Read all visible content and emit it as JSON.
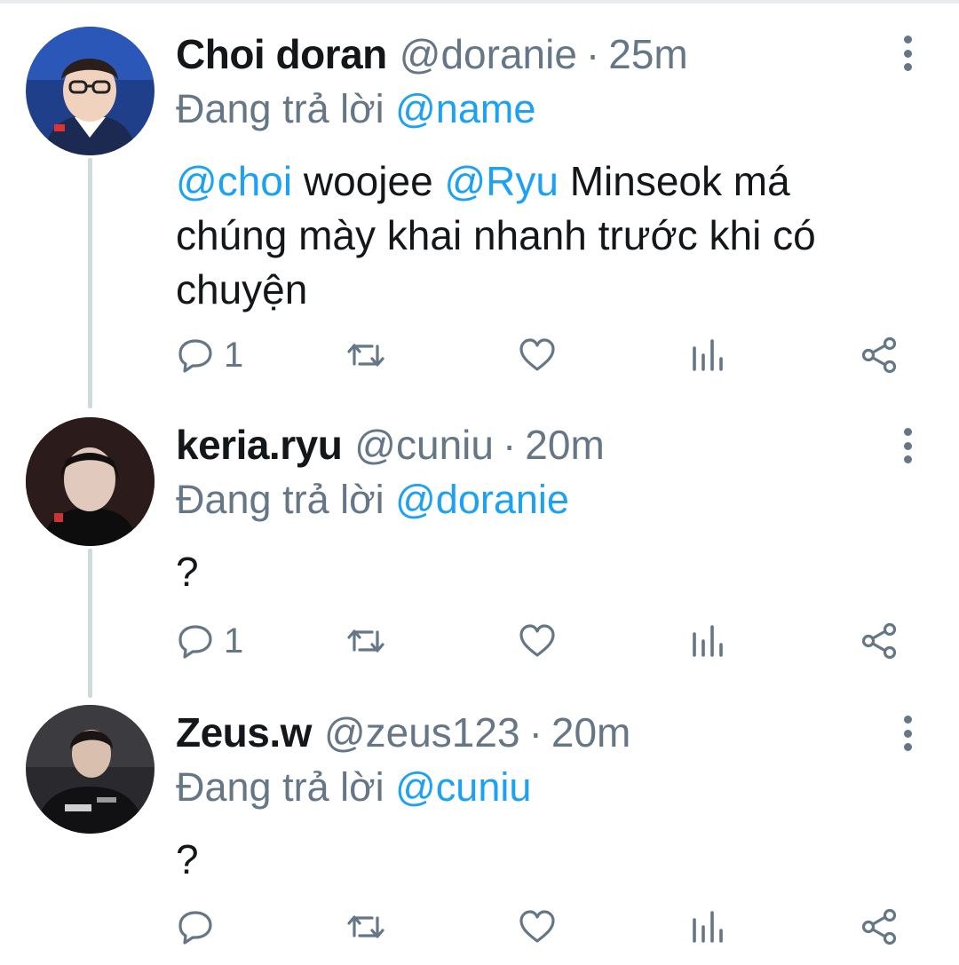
{
  "tweets": [
    {
      "name": "Choi doran",
      "handle": "@doranie",
      "separator": "·",
      "time": "25m",
      "replying_prefix": "Đang trả lời",
      "replying_to": "@name",
      "text_parts": [
        "@choi",
        " woojee ",
        "@Ryu",
        " Minseok má chúng mày khai nhanh trước khi có chuyện"
      ],
      "reply_count": "1",
      "avatar_bg": "#1f3f8a"
    },
    {
      "name": "keria.ryu",
      "handle": "@cuniu",
      "separator": "·",
      "time": "20m",
      "replying_prefix": "Đang trả lời",
      "replying_to": "@doranie",
      "text": "?",
      "reply_count": "1",
      "avatar_bg": "#1a1212"
    },
    {
      "name": "Zeus.w",
      "handle": "@zeus123",
      "separator": "·",
      "time": "20m",
      "replying_prefix": "Đang trả lời",
      "replying_to": "@cuniu",
      "text": "?",
      "reply_count": "",
      "avatar_bg": "#2a2a2e"
    }
  ],
  "icons": {
    "reply": "reply-icon",
    "retweet": "retweet-icon",
    "like": "heart-icon",
    "views": "analytics-icon",
    "share": "share-icon",
    "more": "more-vertical-icon"
  },
  "colors": {
    "text": "#14171a",
    "muted": "#657786",
    "mention": "#1da1f2",
    "thread_line": "#cfd9de"
  }
}
